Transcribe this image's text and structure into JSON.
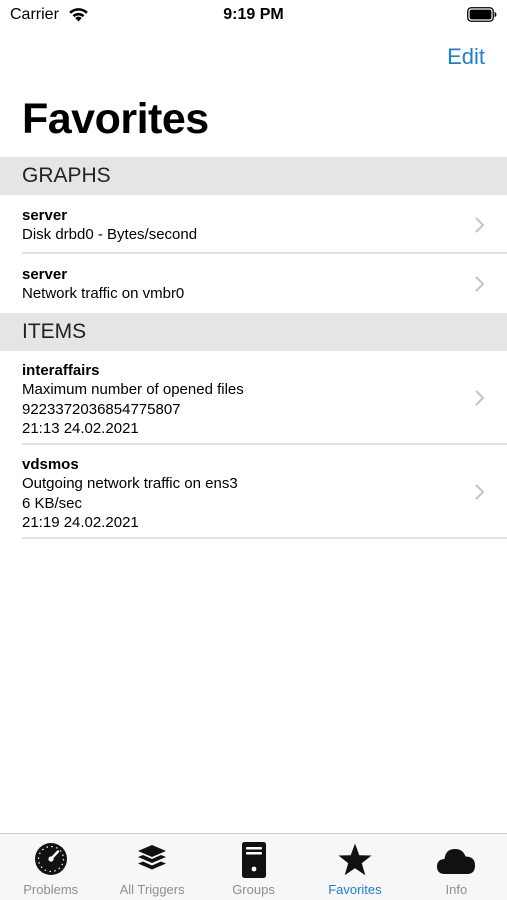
{
  "status_bar": {
    "carrier": "Carrier",
    "time": "9:19 PM"
  },
  "nav": {
    "edit_label": "Edit",
    "title": "Favorites"
  },
  "sections": {
    "graphs": {
      "header": "GRAPHS",
      "rows": [
        {
          "title": "server",
          "lines": [
            "Disk drbd0 - Bytes/second"
          ]
        },
        {
          "title": "server",
          "lines": [
            "Network traffic on vmbr0"
          ]
        }
      ]
    },
    "items": {
      "header": "ITEMS",
      "rows": [
        {
          "title": "interaffairs",
          "lines": [
            "Maximum number of opened files",
            "9223372036854775807",
            "21:13 24.02.2021"
          ]
        },
        {
          "title": "vdsmos",
          "lines": [
            "Outgoing network traffic on ens3",
            "6 KB/sec",
            "21:19 24.02.2021"
          ]
        }
      ]
    }
  },
  "tab_bar": {
    "tabs": [
      {
        "label": "Problems",
        "icon": "gauge-icon"
      },
      {
        "label": "All Triggers",
        "icon": "layers-icon"
      },
      {
        "label": "Groups",
        "icon": "server-tower-icon"
      },
      {
        "label": "Favorites",
        "icon": "star-icon",
        "active": true
      },
      {
        "label": "Info",
        "icon": "cloud-icon"
      }
    ]
  },
  "colors": {
    "accent": "#1a7fd6",
    "section_background": "#e5e5e5",
    "inactive_tab": "#8e8e8e"
  }
}
